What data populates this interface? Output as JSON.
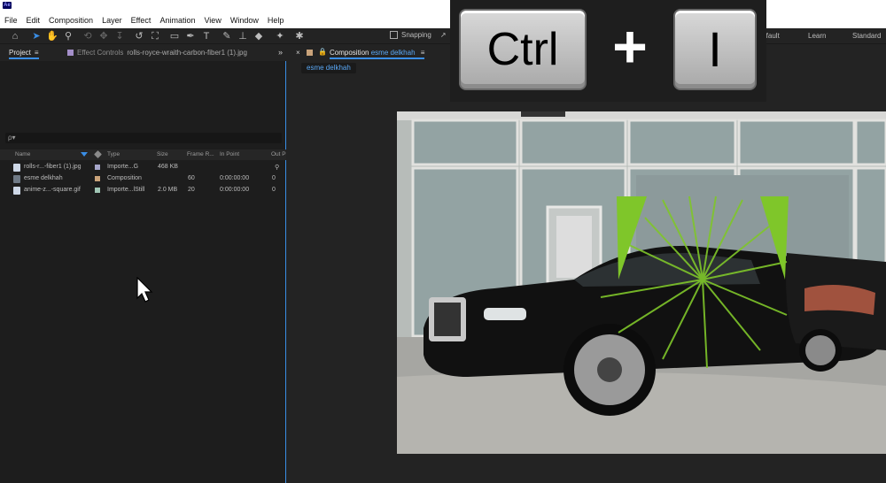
{
  "app": {
    "icon_label": "Ae"
  },
  "menu": [
    "File",
    "Edit",
    "Composition",
    "Layer",
    "Effect",
    "Animation",
    "View",
    "Window",
    "Help"
  ],
  "toolbar": {
    "snapping_label": "Snapping",
    "workspaces": [
      "...fault",
      "Learn",
      "Standard"
    ]
  },
  "project_panel": {
    "tab_label": "Project",
    "effect_controls_label": "Effect Controls",
    "effect_controls_file": "rolls-royce-wraith-carbon-fiber1 (1).jpg",
    "search_placeholder": "ρ▾",
    "columns": [
      "Name",
      "Type",
      "Size",
      "Frame R...",
      "In Point",
      "Out P"
    ],
    "items": [
      {
        "name": "rolls-r...-fiber1 (1).jpg",
        "type": "Importe...G",
        "size": "468 KB",
        "frame_rate": "",
        "in_point": "",
        "label_color": "#a6a6c9"
      },
      {
        "name": "esme delkhah",
        "type": "Composition",
        "size": "",
        "frame_rate": "60",
        "in_point": "0:00:00:00",
        "out": "0",
        "label_color": "#c9a37a"
      },
      {
        "name": "anime-z...-square.gif",
        "type": "Importe...lStill",
        "size": "2.0 MB",
        "frame_rate": "20",
        "in_point": "0:00:00:00",
        "out": "0",
        "label_color": "#a0c6b5"
      }
    ]
  },
  "composition_panel": {
    "tab_prefix": "Composition",
    "comp_name": "esme delkhah",
    "subtab": "esme delkhah"
  },
  "overlay_keys": {
    "key1": "Ctrl",
    "plus": "+",
    "key2": "I"
  },
  "colors": {
    "accent": "#3a8ee6",
    "green_burst": "#7fc62a"
  }
}
